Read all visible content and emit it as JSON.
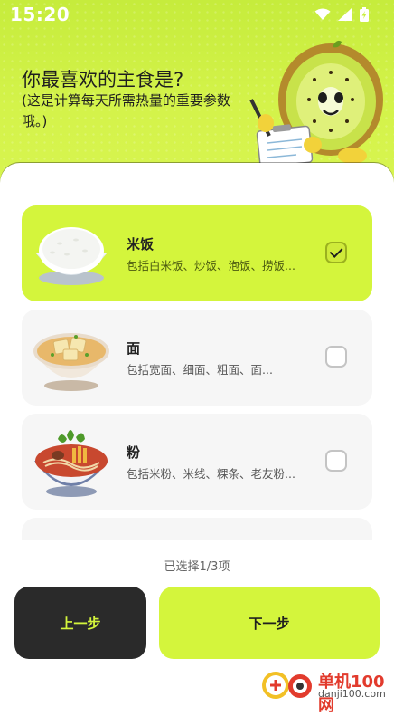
{
  "status_bar": {
    "time": "15:20",
    "icons": [
      "wifi-icon",
      "signal-icon",
      "battery-charging-icon"
    ]
  },
  "question": {
    "title": "你最喜欢的主食是?",
    "subtitle": "(这是计算每天所需热量的重要参数哦。)"
  },
  "options": [
    {
      "name": "米饭",
      "desc": "包括白米饭、炒饭、泡饭、捞饭...",
      "selected": true,
      "image": "rice-bowl-image"
    },
    {
      "name": "面",
      "desc": "包括宽面、细面、粗面、面...",
      "selected": false,
      "image": "noodle-bowl-image"
    },
    {
      "name": "粉",
      "desc": "包括米粉、米线、粿条、老友粉...",
      "selected": false,
      "image": "rice-noodle-bowl-image"
    }
  ],
  "footer": {
    "selection_count": "已选择1/3项",
    "prev_label": "上一步",
    "next_label": "下一步"
  },
  "watermark": {
    "brand": "单机100网",
    "domain": "danji100.com"
  },
  "colors": {
    "accent": "#d4f53c",
    "dark_button": "#2a2a2a",
    "card_bg": "#f6f6f6"
  }
}
